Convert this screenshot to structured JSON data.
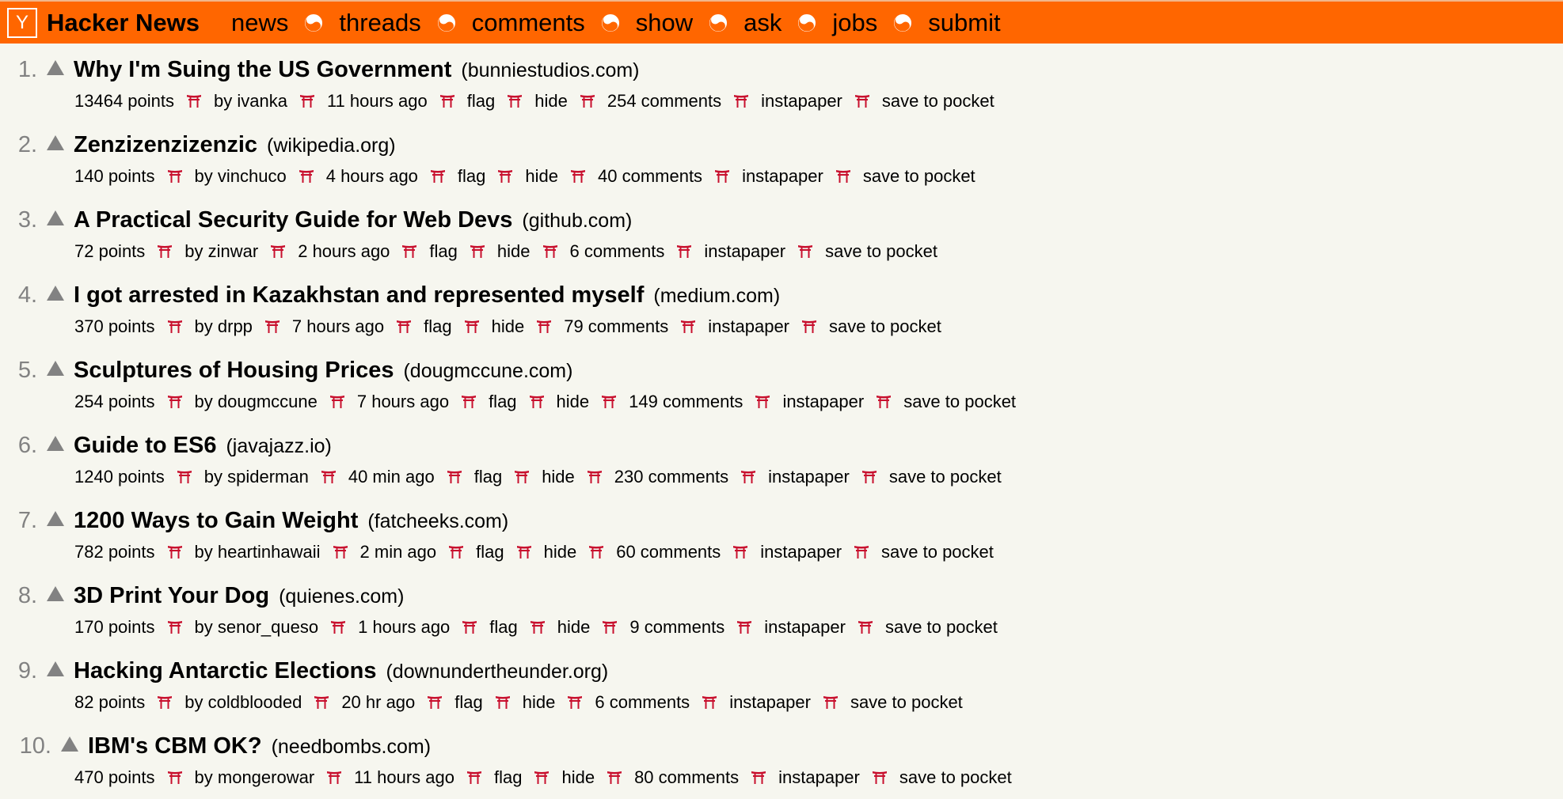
{
  "header": {
    "logo": "Y",
    "title": "Hacker News",
    "nav": [
      "news",
      "threads",
      "comments",
      "show",
      "ask",
      "jobs",
      "submit"
    ],
    "separator_icon": "yin-yang-icon",
    "bar_color": "#ff6600"
  },
  "labels": {
    "flag": "flag",
    "hide": "hide",
    "instapaper": "instapaper",
    "pocket": "save to pocket",
    "separator_icon": "torii-gate-icon"
  },
  "stories": [
    {
      "rank": "1.",
      "title": "Why I'm Suing the US Government",
      "site": "(bunniestudios.com)",
      "points": "13464 points",
      "by": "by ivanka",
      "age": "11 hours ago",
      "comments": "254 comments"
    },
    {
      "rank": "2.",
      "title": "Zenzizenzizenzic",
      "site": "(wikipedia.org)",
      "points": "140 points",
      "by": "by vinchuco",
      "age": "4 hours ago",
      "comments": "40 comments"
    },
    {
      "rank": "3.",
      "title": "A Practical Security Guide for Web Devs",
      "site": "(github.com)",
      "points": "72 points",
      "by": "by zinwar",
      "age": "2 hours ago",
      "comments": "6 comments"
    },
    {
      "rank": "4.",
      "title": "I got arrested in Kazakhstan and represented myself",
      "site": "(medium.com)",
      "points": "370 points",
      "by": "by drpp",
      "age": "7 hours ago",
      "comments": "79 comments"
    },
    {
      "rank": "5.",
      "title": "Sculptures of Housing Prices",
      "site": "(dougmccune.com)",
      "points": "254 points",
      "by": "by dougmccune",
      "age": "7 hours ago",
      "comments": "149 comments"
    },
    {
      "rank": "6.",
      "title": "Guide to ES6",
      "site": "(javajazz.io)",
      "points": "1240 points",
      "by": "by spiderman",
      "age": "40 min ago",
      "comments": "230 comments"
    },
    {
      "rank": "7.",
      "title": "1200 Ways to Gain Weight",
      "site": "(fatcheeks.com)",
      "points": "782 points",
      "by": "by heartinhawaii",
      "age": "2 min ago",
      "comments": "60 comments"
    },
    {
      "rank": "8.",
      "title": "3D Print Your Dog",
      "site": "(quienes.com)",
      "points": "170 points",
      "by": "by senor_queso",
      "age": "1 hours ago",
      "comments": "9 comments"
    },
    {
      "rank": "9.",
      "title": "Hacking Antarctic Elections",
      "site": "(downundertheunder.org)",
      "points": "82 points",
      "by": "by coldblooded",
      "age": "20 hr ago",
      "comments": "6 comments"
    },
    {
      "rank": "10.",
      "title": "IBM's CBM OK?",
      "site": "(needbombs.com)",
      "points": "470 points",
      "by": "by mongerowar",
      "age": "11 hours ago",
      "comments": "80 comments"
    }
  ]
}
